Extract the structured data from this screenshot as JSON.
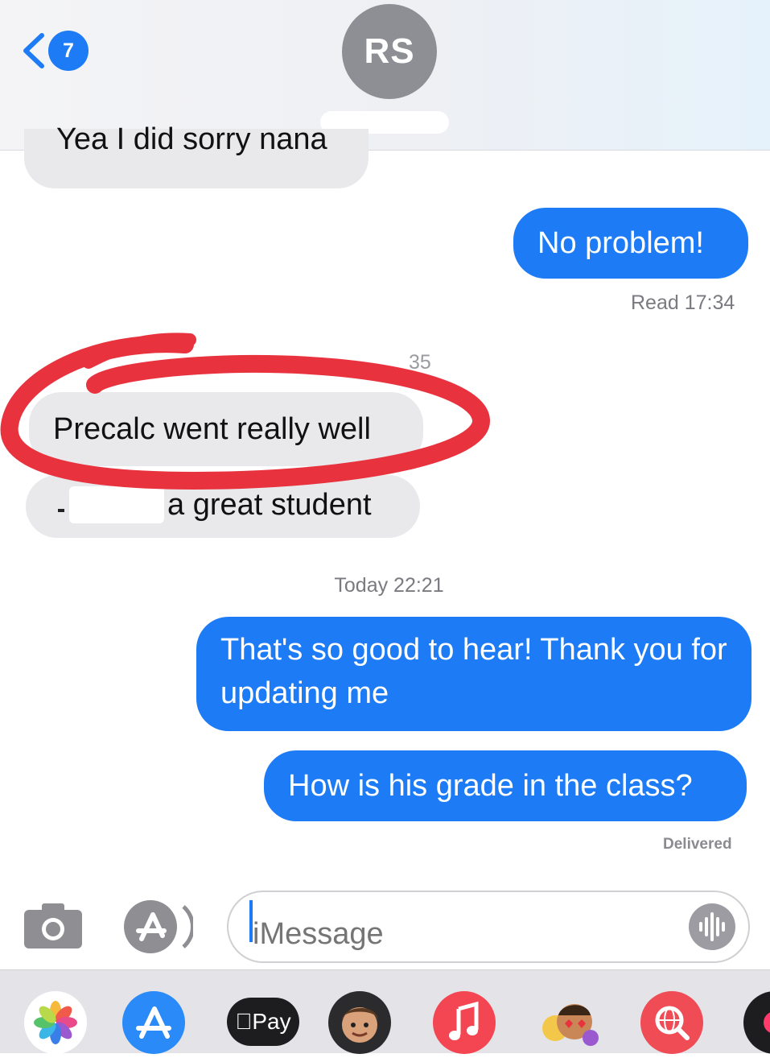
{
  "header": {
    "back_badge": "7",
    "contact_initials": "RS"
  },
  "messages": [
    {
      "from": "contact",
      "text": "Yea I did sorry nana"
    },
    {
      "from": "me",
      "text": "No problem!"
    },
    {
      "from": "contact",
      "text": "Precalc went really well"
    },
    {
      "from": "contact",
      "text": "a great student"
    },
    {
      "from": "me",
      "text": "That's so good to hear! Thank you for updating me"
    },
    {
      "from": "me",
      "text": "How is his grade in the class?"
    }
  ],
  "meta": {
    "read_receipt": "Read 17:34",
    "partial_timestamp": "35",
    "day_separator": "Today 22:21",
    "delivered": "Delivered"
  },
  "composer": {
    "placeholder": "iMessage"
  },
  "app_drawer": {
    "pay_label": "Pay",
    "items": [
      "photos-icon",
      "app-store-icon",
      "apple-pay-icon",
      "memoji-icon",
      "music-icon",
      "stickers-icon",
      "web-search-icon",
      "more-icon"
    ]
  },
  "colors": {
    "sent_bubble": "#1d7bf5",
    "received_bubble": "#e9e9eb",
    "annotation": "#e8333f"
  }
}
